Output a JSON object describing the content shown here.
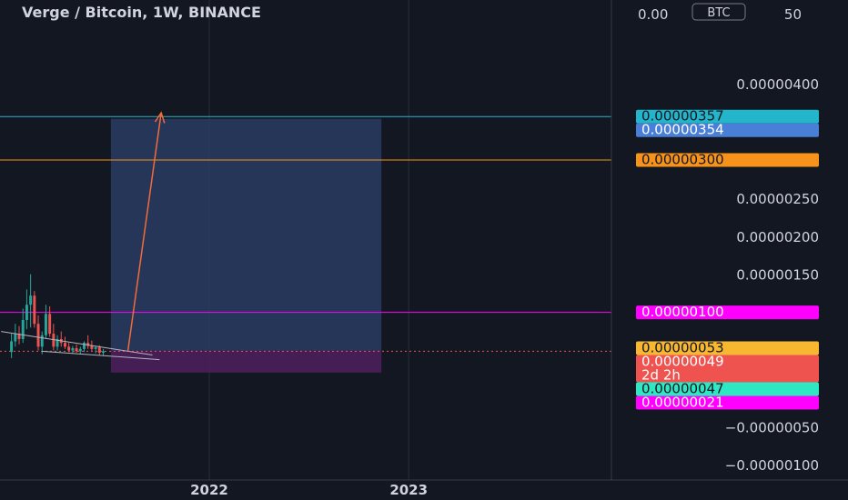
{
  "chart_title": "Verge / Bitcoin, 1W, BINANCE",
  "currency_badge": "BTC",
  "colors": {
    "background": "#131722",
    "grid": "#2a2e39",
    "axis_text": "#d1d4dc",
    "up_candle": "#26a69a",
    "down_candle": "#ef5350",
    "target_zone": "#2a3f66",
    "stop_zone": "#4a1f5a",
    "arrow": "#f26b3a",
    "cyan_line": "#23b5c9",
    "orange_line": "#f7931a",
    "magenta_line": "#ff00ff"
  },
  "chart_data": {
    "type": "candlestick",
    "title": "Verge / Bitcoin, 1W, BINANCE",
    "ylim": [
      -1.2e-06,
      5.1e-06
    ],
    "y_ticks": [
      {
        "value": 4e-06,
        "label": "0.00000400"
      },
      {
        "value": 2.5e-06,
        "label": "0.00000250"
      },
      {
        "value": 2e-06,
        "label": "0.00000200"
      },
      {
        "value": 1.5e-06,
        "label": "0.00000150"
      },
      {
        "value": -5e-07,
        "label": "−0.00000050"
      },
      {
        "value": -1e-06,
        "label": "−0.00000100"
      }
    ],
    "partial_top_tick": {
      "left": "0.00",
      "right": "50"
    },
    "x_ticks": [
      {
        "date": "2022-01-01",
        "label": "2022"
      },
      {
        "date": "2023-01-01",
        "label": "2023"
      }
    ],
    "x_range": [
      "2020-12-14",
      "2024-01-07"
    ],
    "candles": [
      {
        "date": "2021-01-04",
        "open": 4.8e-07,
        "high": 7.2e-07,
        "low": 4e-07,
        "close": 6.2e-07
      },
      {
        "date": "2021-01-11",
        "open": 6.2e-07,
        "high": 8.5e-07,
        "low": 5.5e-07,
        "close": 7.2e-07
      },
      {
        "date": "2021-01-18",
        "open": 7.2e-07,
        "high": 8.2e-07,
        "low": 5.8e-07,
        "close": 6.5e-07
      },
      {
        "date": "2021-01-25",
        "open": 6.5e-07,
        "high": 1.05e-06,
        "low": 6e-07,
        "close": 9e-07
      },
      {
        "date": "2021-02-01",
        "open": 9e-07,
        "high": 1.3e-06,
        "low": 7.8e-07,
        "close": 1.1e-06
      },
      {
        "date": "2021-02-08",
        "open": 1.1e-06,
        "high": 1.5e-06,
        "low": 8e-07,
        "close": 1.22e-06
      },
      {
        "date": "2021-02-15",
        "open": 1.22e-06,
        "high": 1.28e-06,
        "low": 8e-07,
        "close": 8.5e-07
      },
      {
        "date": "2021-02-22",
        "open": 8.5e-07,
        "high": 9.6e-07,
        "low": 5e-07,
        "close": 5.5e-07
      },
      {
        "date": "2021-03-01",
        "open": 5.5e-07,
        "high": 7.5e-07,
        "low": 4.5e-07,
        "close": 7e-07
      },
      {
        "date": "2021-03-08",
        "open": 7e-07,
        "high": 1.1e-06,
        "low": 6.5e-07,
        "close": 9.8e-07
      },
      {
        "date": "2021-03-15",
        "open": 9.8e-07,
        "high": 1.08e-06,
        "low": 6.8e-07,
        "close": 7.2e-07
      },
      {
        "date": "2021-03-22",
        "open": 7.2e-07,
        "high": 8.5e-07,
        "low": 5e-07,
        "close": 5.5e-07
      },
      {
        "date": "2021-03-29",
        "open": 5.5e-07,
        "high": 7e-07,
        "low": 5e-07,
        "close": 6.5e-07
      },
      {
        "date": "2021-04-05",
        "open": 6.5e-07,
        "high": 7.5e-07,
        "low": 5.5e-07,
        "close": 6e-07
      },
      {
        "date": "2021-04-12",
        "open": 6e-07,
        "high": 6.8e-07,
        "low": 5.2e-07,
        "close": 5.5e-07
      },
      {
        "date": "2021-04-19",
        "open": 5.5e-07,
        "high": 6e-07,
        "low": 4.8e-07,
        "close": 5e-07
      },
      {
        "date": "2021-04-26",
        "open": 5e-07,
        "high": 5.6e-07,
        "low": 4.6e-07,
        "close": 5.3e-07
      },
      {
        "date": "2021-05-03",
        "open": 5.3e-07,
        "high": 5.8e-07,
        "low": 4.7e-07,
        "close": 4.9e-07
      },
      {
        "date": "2021-05-10",
        "open": 4.9e-07,
        "high": 5.5e-07,
        "low": 4.5e-07,
        "close": 5.2e-07
      },
      {
        "date": "2021-05-17",
        "open": 5.2e-07,
        "high": 6.2e-07,
        "low": 4.8e-07,
        "close": 6e-07
      },
      {
        "date": "2021-05-24",
        "open": 6e-07,
        "high": 7e-07,
        "low": 5.2e-07,
        "close": 5.6e-07
      },
      {
        "date": "2021-05-31",
        "open": 5.6e-07,
        "high": 6.3e-07,
        "low": 4.9e-07,
        "close": 5.2e-07
      },
      {
        "date": "2021-06-07",
        "open": 5.2e-07,
        "high": 5.6e-07,
        "low": 4.6e-07,
        "close": 5.4e-07
      },
      {
        "date": "2021-06-14",
        "open": 5.4e-07,
        "high": 5.7e-07,
        "low": 4.4e-07,
        "close": 4.7e-07
      },
      {
        "date": "2021-06-21",
        "open": 4.7e-07,
        "high": 5.2e-07,
        "low": 4.3e-07,
        "close": 4.9e-07
      }
    ],
    "trendline": {
      "start": {
        "date": "2020-12-16",
        "value": 7.5e-07
      },
      "end": {
        "date": "2021-09-19",
        "value": 4.4e-07
      }
    },
    "support_line": {
      "start": {
        "date": "2021-03-01",
        "value": 4.9e-07
      },
      "end": {
        "date": "2021-10-02",
        "value": 3.8e-07
      }
    },
    "target_zone": {
      "start": "2021-07-05",
      "end": "2022-11-12",
      "top": 3.54e-06,
      "bottom": 5e-07
    },
    "stop_zone": {
      "start": "2021-07-05",
      "end": "2022-11-12",
      "top": 5e-07,
      "bottom": 2.1e-07
    },
    "arrow": {
      "from": {
        "date": "2021-08-05",
        "value": 4.9e-07
      },
      "to": {
        "date": "2021-10-05",
        "value": 3.62e-06
      }
    },
    "horizontal_lines": [
      {
        "value": 3.57e-06,
        "color": "#23b5c9"
      },
      {
        "value": 3e-06,
        "color": "#f7931a"
      },
      {
        "value": 1e-06,
        "color": "#ff00ff"
      }
    ],
    "price_line": {
      "value": 4.9e-07,
      "color": "#ef5350"
    },
    "labels": [
      {
        "value": 3.57e-06,
        "text": "0.00000357",
        "bg": "#23b5c9",
        "fg": "#131722"
      },
      {
        "value": 3.54e-06,
        "text": "0.00000354",
        "bg": "#4a7fd8",
        "fg": "#ffffff"
      },
      {
        "value": 3e-06,
        "text": "0.00000300",
        "bg": "#f7931a",
        "fg": "#131722"
      },
      {
        "value": 1e-06,
        "text": "0.00000100",
        "bg": "#ff00ff",
        "fg": "#ffffff"
      },
      {
        "value": 5.3e-07,
        "text": "0.00000053",
        "bg": "#f7b731",
        "fg": "#131722"
      },
      {
        "value": 4.9e-07,
        "text": "0.00000049",
        "bg": "#ef5350",
        "fg": "#ffffff",
        "sub": "2d 2h"
      },
      {
        "value": 4.7e-07,
        "text": "0.00000047",
        "bg": "#2ee8c4",
        "fg": "#131722"
      },
      {
        "value": 2.1e-07,
        "text": "0.00000021",
        "bg": "#ff00ff",
        "fg": "#ffffff"
      }
    ]
  }
}
